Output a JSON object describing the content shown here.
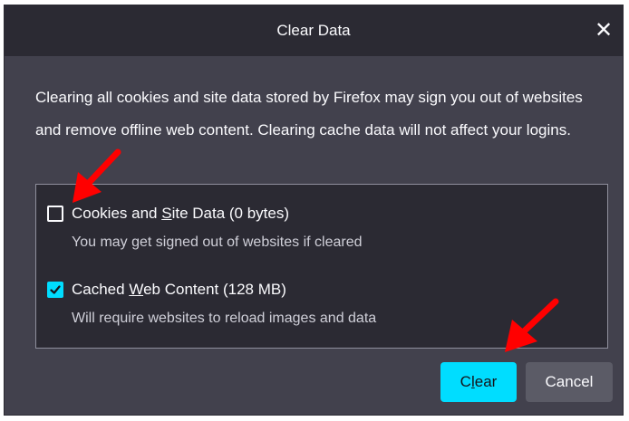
{
  "dialog": {
    "title": "Clear Data",
    "close_icon": "close-icon",
    "description": "Clearing all cookies and site data stored by Firefox may sign you out of websites and remove offline web content. Clearing cache data will not affect your logins.",
    "options": [
      {
        "label_before": "Cookies and ",
        "label_access": "S",
        "label_after": "ite Data (0 bytes)",
        "description": "You may get signed out of websites if cleared",
        "checked": false
      },
      {
        "label_before": "Cached ",
        "label_access": "W",
        "label_after": "eb Content (128 MB)",
        "description": "Will require websites to reload images and data",
        "checked": true
      }
    ],
    "buttons": {
      "clear_before": "C",
      "clear_access": "l",
      "clear_after": "ear",
      "cancel": "Cancel"
    }
  },
  "colors": {
    "dialog_bg": "#42414d",
    "titlebar_bg": "#2b2a33",
    "accent": "#00ddff",
    "annotation_arrow": "#ff0000"
  }
}
